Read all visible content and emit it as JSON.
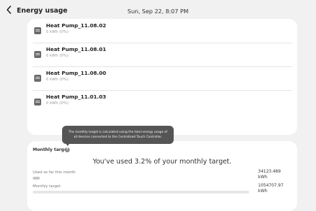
{
  "header": {
    "title": "Energy usage",
    "datetime": "Sun, Sep 22, 8:07 PM"
  },
  "devices": [
    {
      "name": "Heat Pump_11.08.02",
      "usage": "0 kWh (0%)",
      "icon": "heat-pump-icon"
    },
    {
      "name": "Heat Pump_11.08.01",
      "usage": "0 kWh (0%)",
      "icon": "heat-pump-icon"
    },
    {
      "name": "Heat Pump_11.08.00",
      "usage": "0 kWh (0%)",
      "icon": "heat-pump-icon"
    },
    {
      "name": "Heat Pump_11.01.03",
      "usage": "0 kWh (0%)",
      "icon": "heat-pump-icon"
    }
  ],
  "tooltip": {
    "line1": "The monthly target is calculated using the total energy usage of",
    "line2": "all devices connected to the Centralized Touch Controller."
  },
  "monthly_target": {
    "label": "Monthly target",
    "help_icon": "help-icon",
    "headline": "You've used 3.2% of your monthly target.",
    "used_label": "Used so far this month",
    "used_value_number": "34123.489",
    "used_value_unit": "kWh",
    "used_fraction": 0.032,
    "target_label": "Monthly target",
    "target_value_number": "1054707.97",
    "target_value_unit": "kWh"
  },
  "colors": {
    "background": "#f1f1f1",
    "card": "#ffffff",
    "tooltip": "#555556",
    "used_bar": "#c6c6c6",
    "target_bar": "#e6e6e6"
  }
}
